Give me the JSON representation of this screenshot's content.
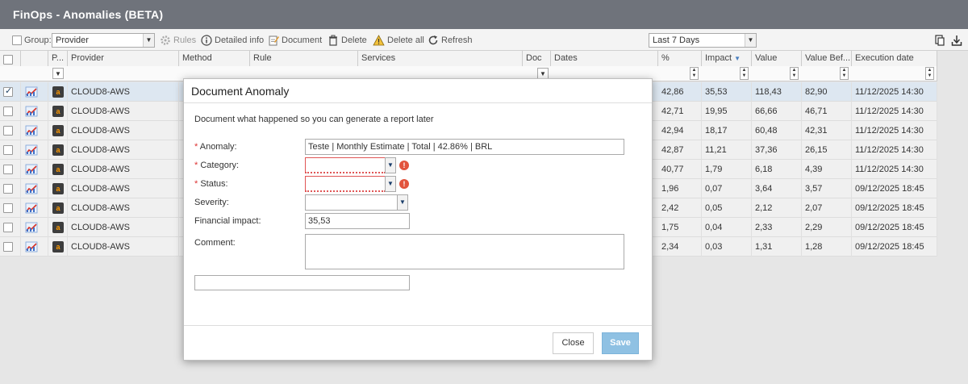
{
  "app_title": "FinOps - Anomalies (BETA)",
  "toolbar": {
    "group_label": "Group:",
    "group_value": "Provider",
    "rules": "Rules",
    "detailed_info": "Detailed info",
    "document": "Document",
    "delete": "Delete",
    "delete_all": "Delete all",
    "refresh": "Refresh",
    "period_value": "Last 7 Days"
  },
  "columns": {
    "p": "P...",
    "provider": "Provider",
    "method": "Method",
    "rule": "Rule",
    "services": "Services",
    "doc": "Doc",
    "dates": "Dates",
    "pct": "%",
    "impact": "Impact",
    "value": "Value",
    "value_before": "Value Bef...",
    "execution_date": "Execution date"
  },
  "rows": [
    {
      "provider": "CLOUD8-AWS",
      "pct": "42,86",
      "impact": "35,53",
      "value": "118,43",
      "value_before": "82,90",
      "execution_date": "11/12/2025 14:30",
      "selected": true
    },
    {
      "provider": "CLOUD8-AWS",
      "pct": "42,71",
      "impact": "19,95",
      "value": "66,66",
      "value_before": "46,71",
      "execution_date": "11/12/2025 14:30"
    },
    {
      "provider": "CLOUD8-AWS",
      "pct": "42,94",
      "impact": "18,17",
      "value": "60,48",
      "value_before": "42,31",
      "execution_date": "11/12/2025 14:30"
    },
    {
      "provider": "CLOUD8-AWS",
      "pct": "42,87",
      "impact": "11,21",
      "value": "37,36",
      "value_before": "26,15",
      "execution_date": "11/12/2025 14:30"
    },
    {
      "provider": "CLOUD8-AWS",
      "pct": "40,77",
      "impact": "1,79",
      "value": "6,18",
      "value_before": "4,39",
      "execution_date": "11/12/2025 14:30"
    },
    {
      "provider": "CLOUD8-AWS",
      "pct": "1,96",
      "impact": "0,07",
      "value": "3,64",
      "value_before": "3,57",
      "execution_date": "09/12/2025 18:45"
    },
    {
      "provider": "CLOUD8-AWS",
      "pct": "2,42",
      "impact": "0,05",
      "value": "2,12",
      "value_before": "2,07",
      "execution_date": "09/12/2025 18:45"
    },
    {
      "provider": "CLOUD8-AWS",
      "pct": "1,75",
      "impact": "0,04",
      "value": "2,33",
      "value_before": "2,29",
      "execution_date": "09/12/2025 18:45"
    },
    {
      "provider": "CLOUD8-AWS",
      "pct": "2,34",
      "impact": "0,03",
      "value": "1,31",
      "value_before": "1,28",
      "execution_date": "09/12/2025 18:45"
    }
  ],
  "modal": {
    "title": "Document Anomaly",
    "description": "Document what happened so you can generate a report later",
    "anomaly_label": "Anomaly:",
    "anomaly_value": "Teste | Monthly Estimate | Total | 42.86% | BRL",
    "category_label": "Category:",
    "category_value": "",
    "status_label": "Status:",
    "status_value": "",
    "severity_label": "Severity:",
    "severity_value": "",
    "financial_impact_label": "Financial impact:",
    "financial_impact_value": "35,53",
    "comment_label": "Comment:",
    "comment_value": "",
    "extra_value": "",
    "required_mark": "*",
    "close_label": "Close",
    "save_label": "Save"
  },
  "colors": {
    "titlebar": "#6f737b",
    "save_button": "#8fc1e3",
    "error": "#e2543d"
  }
}
